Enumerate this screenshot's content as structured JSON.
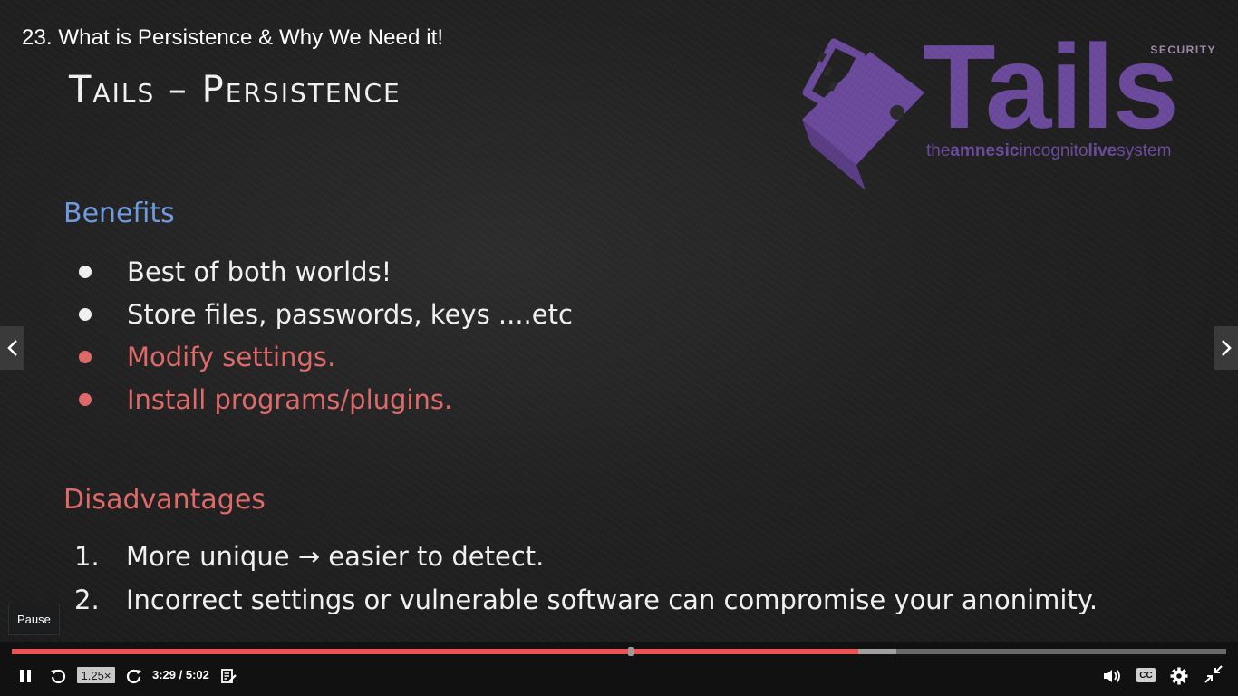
{
  "video": {
    "title": "23. What is Persistence & Why We Need it!"
  },
  "slide": {
    "heading": "Tails – Persistence",
    "benefits_label": "Benefits",
    "benefits": [
      {
        "text": "Best of both worlds!",
        "color": "#f2f2f2"
      },
      {
        "text": "Store files, passwords, keys ....etc",
        "color": "#f2f2f2"
      },
      {
        "text": "Modify settings.",
        "color": "#e06a6a"
      },
      {
        "text": "Install programs/plugins.",
        "color": "#e06a6a"
      }
    ],
    "disadvantages_label": "Disadvantages",
    "disadvantages": [
      {
        "num": "1.",
        "text": "More unique → easier to detect."
      },
      {
        "num": "2.",
        "text": "Incorrect settings or vulnerable software can compromise your anonimity."
      }
    ],
    "logo": {
      "word": "Tails",
      "tag_parts": [
        "the",
        "amnesic",
        "incognito",
        "live",
        "system"
      ],
      "security": "SECURITY",
      "color": "#6b4a9c"
    }
  },
  "tooltip": "Pause",
  "player": {
    "speed": "1.25×",
    "time": "3:29 / 5:02",
    "played_fraction": 0.697,
    "buffered_fraction": 0.728,
    "cc_label": "CC",
    "accent_color": "#ec5252",
    "icons": [
      "pause-icon",
      "rewind-icon",
      "forward-icon",
      "notes-icon",
      "volume-icon",
      "settings-icon",
      "exit-fullscreen-icon",
      "chevron-left-icon",
      "chevron-right-icon"
    ]
  }
}
